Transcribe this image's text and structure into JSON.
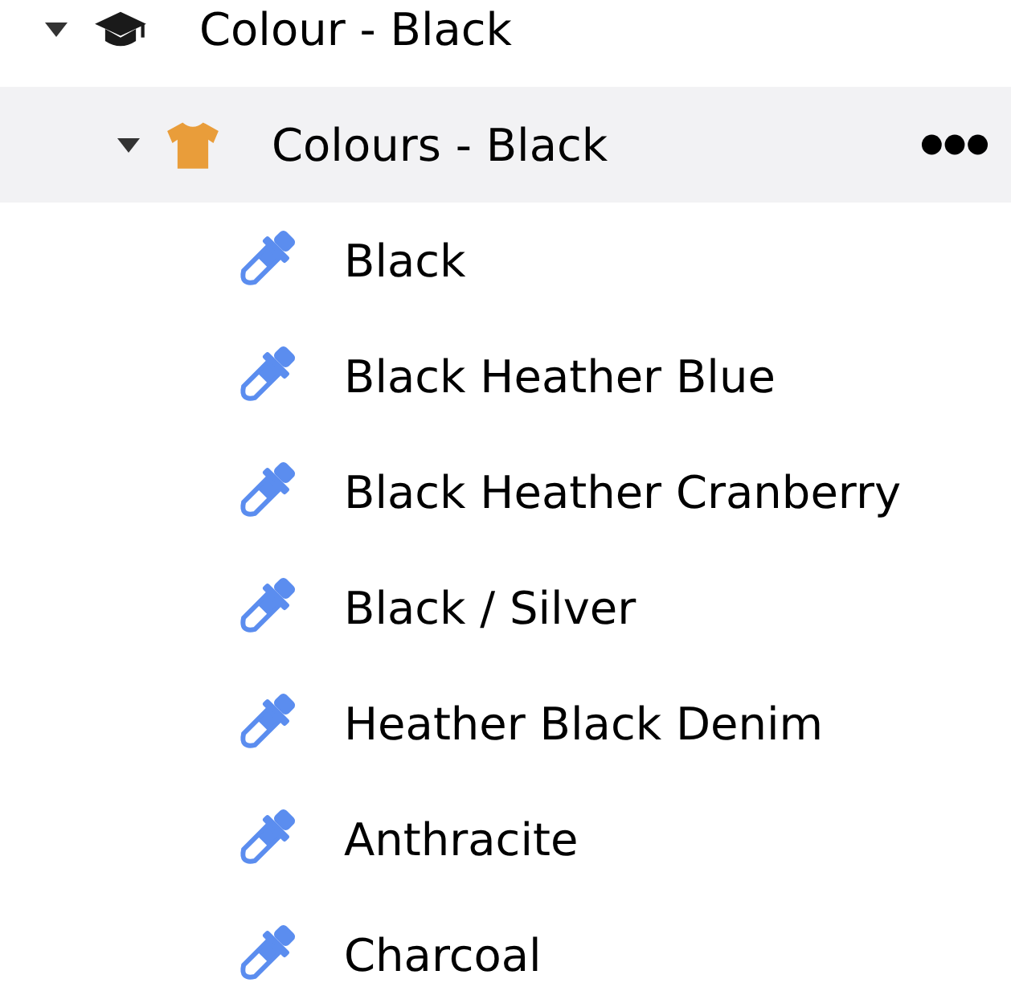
{
  "tree": [
    {
      "label": "Colour - Black",
      "kind": "category",
      "expanded": true,
      "selected": false,
      "children": [
        {
          "label": "Colours - Black",
          "kind": "group",
          "expanded": true,
          "selected": true,
          "children": [
            {
              "label": "Black",
              "kind": "colour",
              "selected": false
            },
            {
              "label": "Black Heather Blue",
              "kind": "colour",
              "selected": false
            },
            {
              "label": "Black Heather Cranberry",
              "kind": "colour",
              "selected": false
            },
            {
              "label": "Black / Silver",
              "kind": "colour",
              "selected": false
            },
            {
              "label": "Heather Black Denim",
              "kind": "colour",
              "selected": false
            },
            {
              "label": "Anthracite",
              "kind": "colour",
              "selected": false
            },
            {
              "label": "Charcoal",
              "kind": "colour",
              "selected": false
            }
          ]
        }
      ]
    }
  ]
}
